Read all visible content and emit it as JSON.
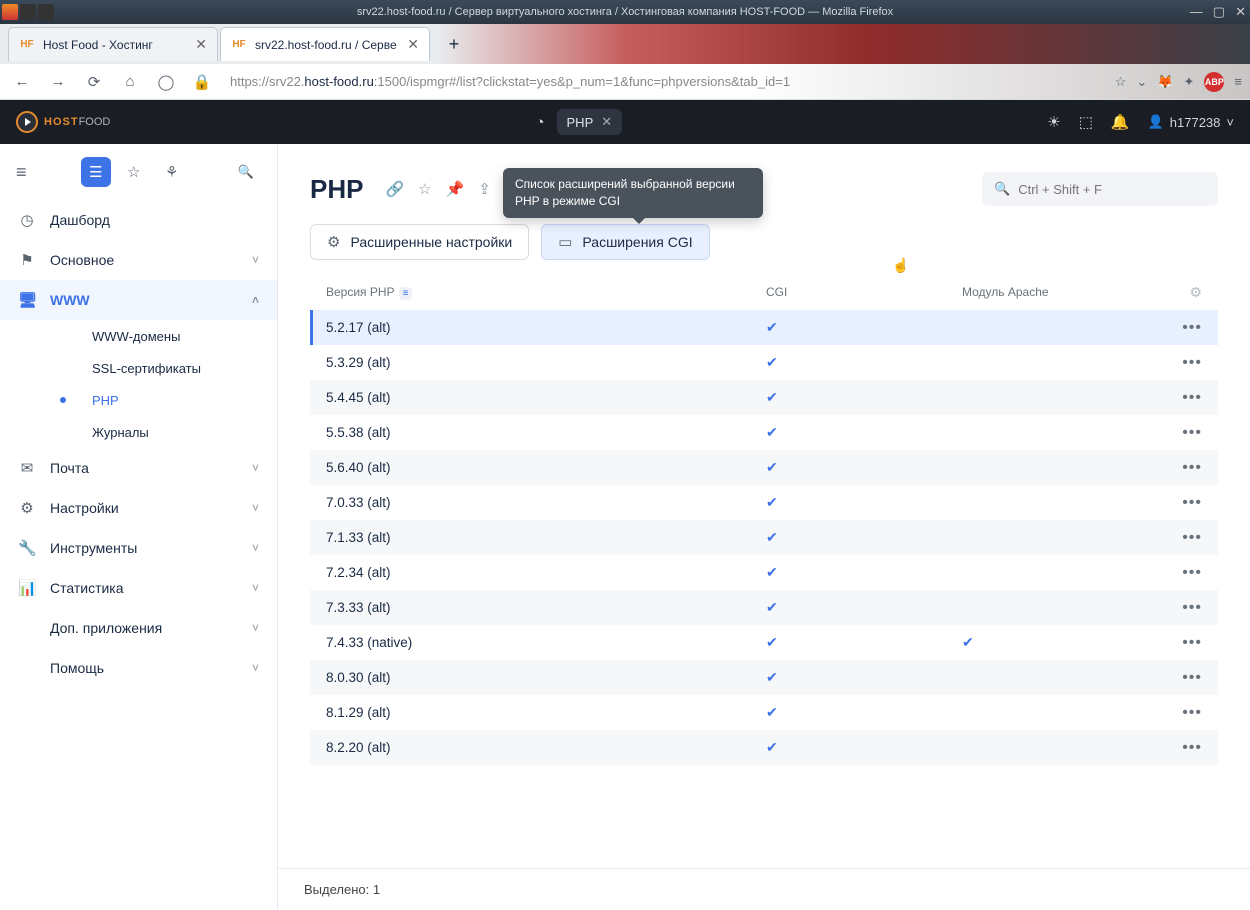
{
  "window_title": "srv22.host-food.ru / Сервер виртуального хостинга / Хостинговая компания HOST-FOOD — Mozilla Firefox",
  "tabs": [
    {
      "label": "Host Food - Хостинг",
      "fav": "HF"
    },
    {
      "label": "srv22.host-food.ru / Серве",
      "fav": "HF"
    }
  ],
  "url": {
    "pre": "https://srv22.",
    "mid": "host-food.ru",
    "post": ":1500/ispmgr#/list?clickstat=yes&p_num=1&func=phpversions&tab_id=1"
  },
  "brand": {
    "a": "HOST",
    "b": "FOOD"
  },
  "user": "h177238",
  "chip": {
    "label": "PHP"
  },
  "sidebar": {
    "dashboard": "Дашборд",
    "sections": [
      {
        "label": "Основное",
        "icon": "⚑"
      },
      {
        "label": "WWW",
        "icon": "🖥",
        "open": true,
        "active": true,
        "children": [
          {
            "label": "WWW-домены"
          },
          {
            "label": "SSL-сертификаты"
          },
          {
            "label": "PHP",
            "cur": true
          },
          {
            "label": "Журналы"
          }
        ]
      },
      {
        "label": "Почта",
        "icon": "✉"
      },
      {
        "label": "Настройки",
        "icon": "⚙"
      },
      {
        "label": "Инструменты",
        "icon": "🔧"
      },
      {
        "label": "Статистика",
        "icon": "📊"
      },
      {
        "label": "Доп. приложения",
        "icon": ""
      },
      {
        "label": "Помощь",
        "icon": ""
      }
    ]
  },
  "page": {
    "title": "PHP",
    "search_placeholder": "Ctrl + Shift + F",
    "btn1": "Расширенные настройки",
    "btn2": "Расширения CGI",
    "tooltip": "Список расширений выбранной версии PHP в режиме CGI"
  },
  "table": {
    "cols": {
      "v": "Версия PHP",
      "c": "CGI",
      "m": "Модуль Apache"
    },
    "rows": [
      {
        "v": "5.2.17 (alt)",
        "cgi": true,
        "mod": false,
        "sel": true
      },
      {
        "v": "5.3.29 (alt)",
        "cgi": true,
        "mod": false
      },
      {
        "v": "5.4.45 (alt)",
        "cgi": true,
        "mod": false
      },
      {
        "v": "5.5.38 (alt)",
        "cgi": true,
        "mod": false
      },
      {
        "v": "5.6.40 (alt)",
        "cgi": true,
        "mod": false
      },
      {
        "v": "7.0.33 (alt)",
        "cgi": true,
        "mod": false
      },
      {
        "v": "7.1.33 (alt)",
        "cgi": true,
        "mod": false
      },
      {
        "v": "7.2.34 (alt)",
        "cgi": true,
        "mod": false
      },
      {
        "v": "7.3.33 (alt)",
        "cgi": true,
        "mod": false
      },
      {
        "v": "7.4.33 (native)",
        "cgi": true,
        "mod": true
      },
      {
        "v": "8.0.30 (alt)",
        "cgi": true,
        "mod": false
      },
      {
        "v": "8.1.29 (alt)",
        "cgi": true,
        "mod": false
      },
      {
        "v": "8.2.20 (alt)",
        "cgi": true,
        "mod": false
      }
    ]
  },
  "footer": "Выделено: 1"
}
